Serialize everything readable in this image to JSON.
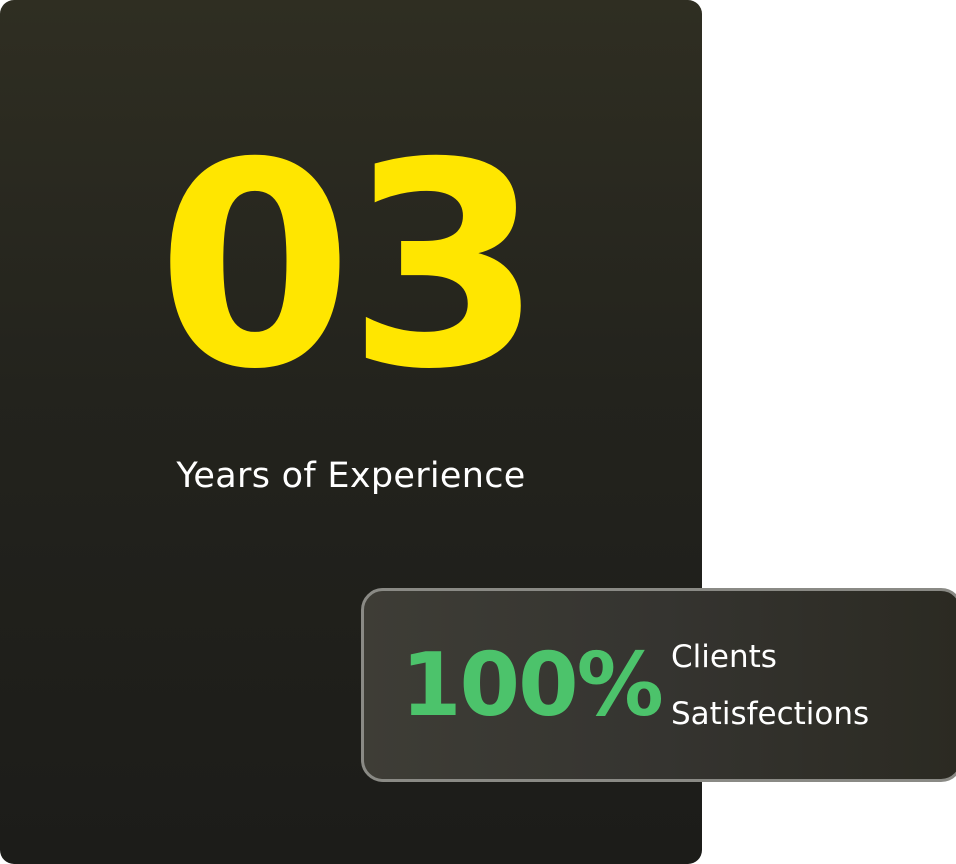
{
  "experience": {
    "value": "03",
    "label": "Years of Experience",
    "value_color": "#ffe600"
  },
  "satisfaction": {
    "value": "100%",
    "label_line1": "Clients",
    "label_line2": "Satisfections",
    "value_color": "#4cc36b"
  }
}
